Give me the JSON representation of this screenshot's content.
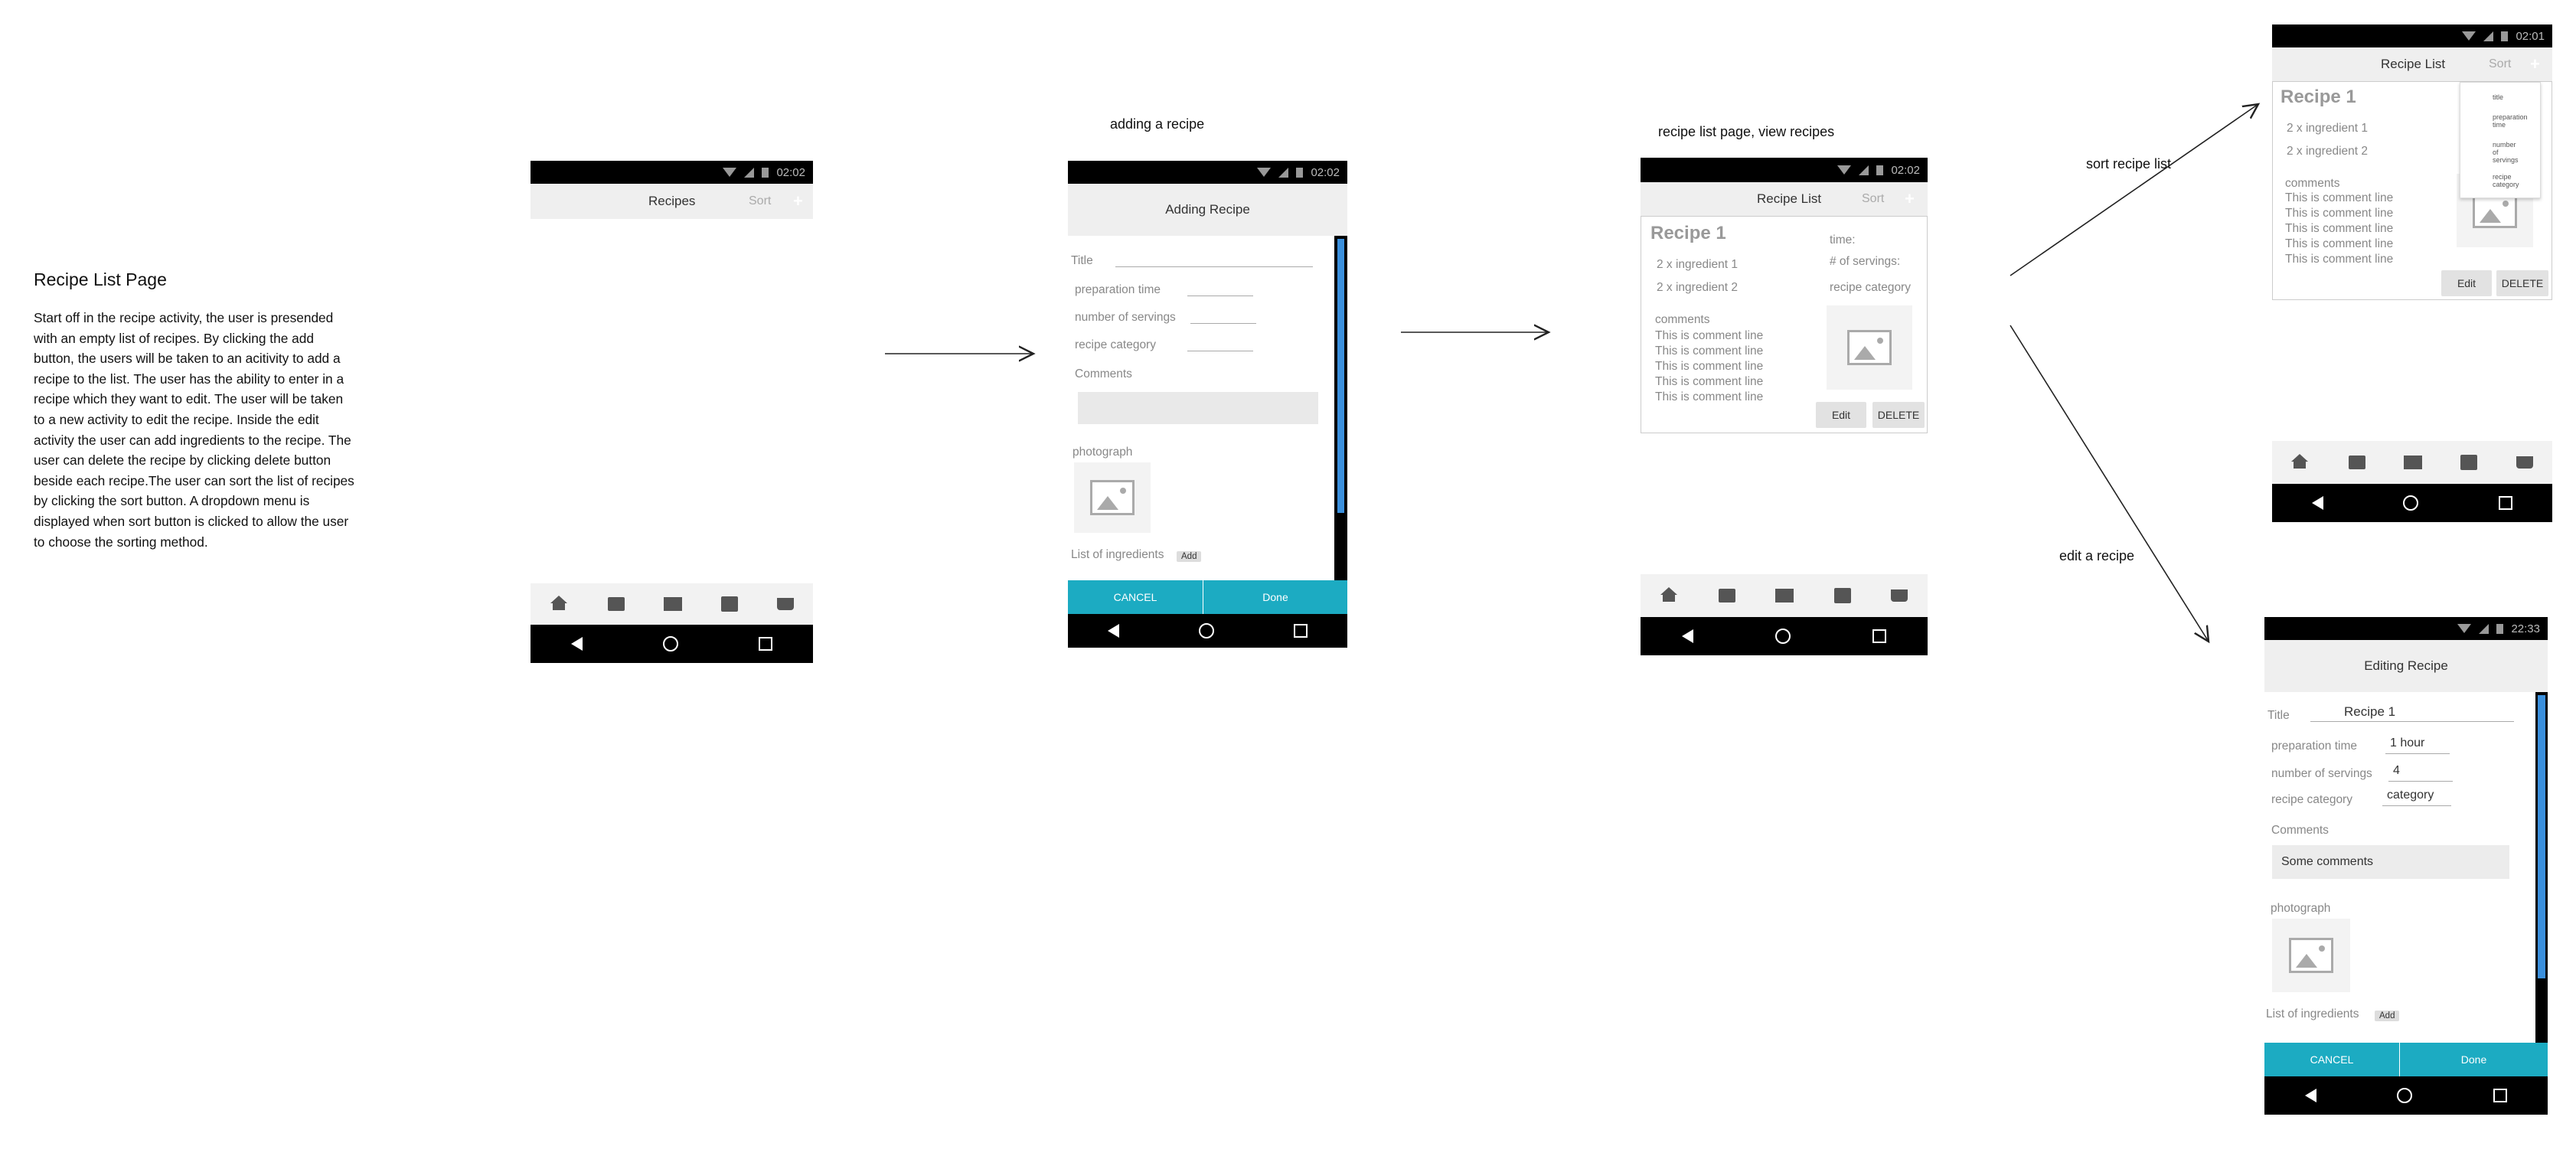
{
  "description": {
    "title": "Recipe List Page",
    "body_lines": [
      "Start off in the recipe activity, the user is presended",
      "with an empty list of recipes. By clicking the add",
      "button, the users will be taken to an acitivity to add a",
      "recipe to the list. The user has the ability to enter in a",
      "recipe which they want to edit. The user will be taken",
      "to a new activity to edit the recipe. Inside the edit",
      "activity the user can add ingredients to the recipe. The",
      "user can delete the recipe by clicking delete button",
      "beside each recipe.The user can sort the list of recipes",
      "by clicking the sort button. A dropdown menu is",
      "displayed when sort button is clicked to allow the user",
      "to choose the sorting method."
    ]
  },
  "captions": {
    "adding": "adding a recipe",
    "list_view": "recipe list page, view recipes",
    "sort": "sort recipe list",
    "edit": "edit a recipe"
  },
  "screen_empty": {
    "time": "02:02",
    "title": "Recipes",
    "sort": "Sort",
    "plus": "+"
  },
  "screen_add": {
    "time": "02:02",
    "title": "Adding Recipe",
    "field_title": "Title",
    "field_prep": "preparation time",
    "field_servings": "number of servings",
    "field_category": "recipe category",
    "comments": "Comments",
    "photograph": "photograph",
    "ingredients": "List of ingredients",
    "add": "Add",
    "cancel": "CANCEL",
    "done": "Done"
  },
  "screen_list": {
    "time": "02:02",
    "title": "Recipe List",
    "sort": "Sort",
    "plus": "+",
    "recipe_name": "Recipe 1",
    "ingredients": [
      "2 x ingredient 1",
      "2 x ingredient 2"
    ],
    "time_label": "time:",
    "servings_label": "# of servings:",
    "category_label": "recipe category",
    "comments_label": "comments",
    "comment_lines": [
      "This is comment line",
      "This is comment line",
      "This is comment line",
      "This is comment line",
      "This is comment line"
    ],
    "edit": "Edit",
    "delete": "DELETE"
  },
  "screen_sort": {
    "time": "02:01",
    "title": "Recipe List",
    "sort": "Sort",
    "plus": "+",
    "recipe_name": "Recipe 1",
    "ingredients": [
      "2 x ingredient 1",
      "2 x ingredient 2"
    ],
    "comments_label": "comments",
    "comment_lines": [
      "This is comment line",
      "This is comment line",
      "This is comment line",
      "This is comment line",
      "This is comment line"
    ],
    "edit": "Edit",
    "delete": "DELETE",
    "dropdown": [
      "title",
      "preparation time",
      "number of servings",
      "recipe category"
    ]
  },
  "screen_edit": {
    "time": "22:33",
    "title": "Editing Recipe",
    "field_title": "Title",
    "value_title": "Recipe 1",
    "field_prep": "preparation time",
    "value_prep": "1 hour",
    "field_servings": "number of servings",
    "value_servings": "4",
    "field_category": "recipe category",
    "value_category": "category",
    "comments": "Comments",
    "value_comments": "Some comments",
    "photograph": "photograph",
    "ingredients": "List of ingredients",
    "add": "Add",
    "cancel": "CANCEL",
    "done": "Done"
  },
  "colors": {
    "teal": "#1cabc2",
    "scroll": "#3a8fdc"
  }
}
